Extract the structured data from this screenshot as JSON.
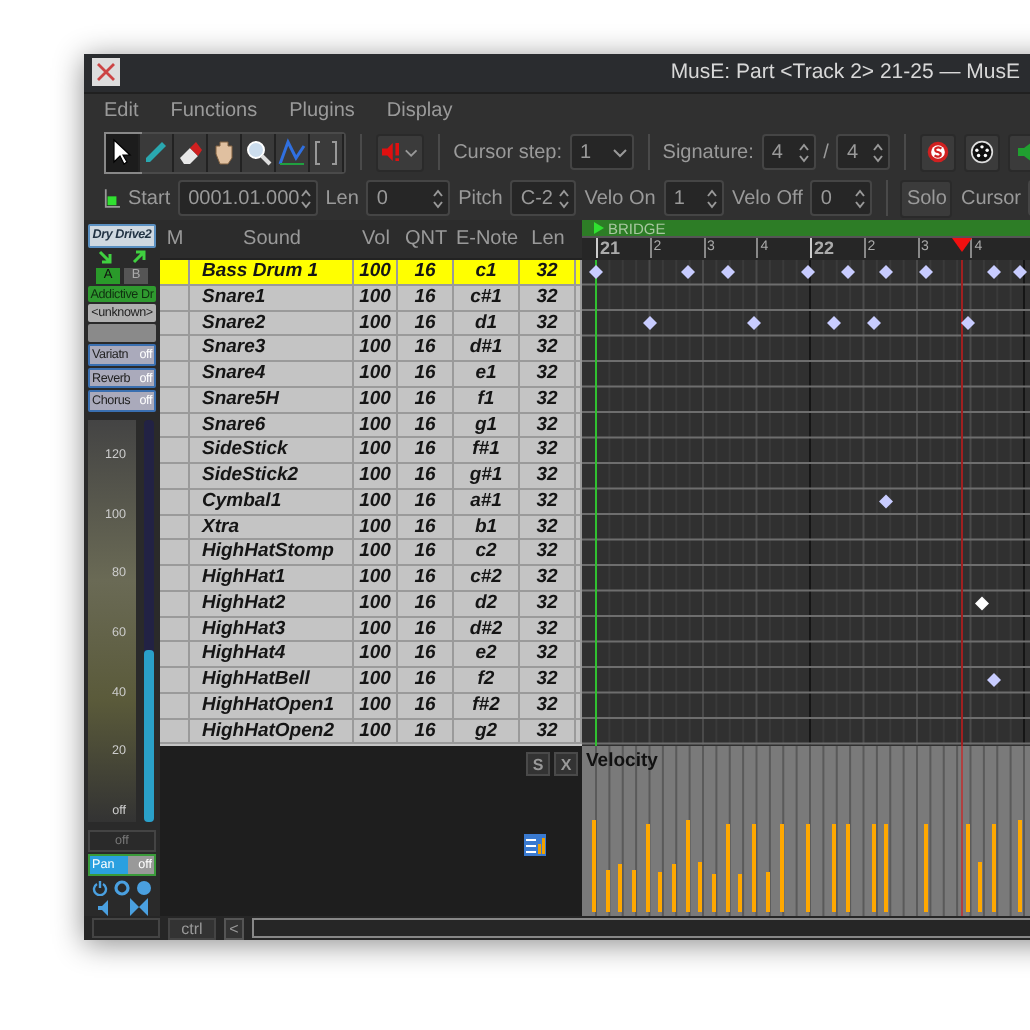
{
  "window": {
    "title": "MusE: Part <Track 2> 21-25 — MusE"
  },
  "menu": [
    "Edit",
    "Functions",
    "Plugins",
    "Display"
  ],
  "tools": [
    {
      "kind": "pointer",
      "selected": true
    },
    {
      "kind": "pencil",
      "selected": false
    },
    {
      "kind": "eraser",
      "selected": false
    },
    {
      "kind": "hand",
      "selected": false
    },
    {
      "kind": "zoom",
      "selected": false
    },
    {
      "kind": "curve",
      "selected": false
    },
    {
      "kind": "range",
      "selected": false
    }
  ],
  "cursor_step": {
    "label": "Cursor step:",
    "value": "1"
  },
  "signature": {
    "label": "Signature:",
    "numerator": "4",
    "separator": "/",
    "denominator": "4"
  },
  "note_info": {
    "start_label": "Start",
    "start": "0001.01.000",
    "len_label": "Len",
    "len": "0",
    "pitch_label": "Pitch",
    "pitch": "C-2",
    "velo_on_label": "Velo On",
    "velo_on": "1",
    "velo_off_label": "Velo Off",
    "velo_off": "0",
    "solo": "Solo",
    "cursor_label": "Cursor"
  },
  "strip": {
    "name": "Dry Drive2",
    "routes": [
      {
        "label": "A",
        "selected": true
      },
      {
        "label": "B",
        "selected": false
      }
    ],
    "instrument": "Addictive Dr",
    "port": "<unknown>",
    "effects": [
      {
        "label": "Variatn",
        "value": "off"
      },
      {
        "label": "Reverb",
        "value": "off"
      },
      {
        "label": "Chorus",
        "value": "off"
      }
    ],
    "scale": [
      "120",
      "100",
      "80",
      "60",
      "40",
      "20",
      "off"
    ],
    "fader": {
      "level": 0.43
    },
    "volume": "off",
    "pan": {
      "label": "Pan",
      "value": "off"
    }
  },
  "columns": [
    "M",
    "Sound",
    "Vol",
    "QNT",
    "E-Note",
    "Len"
  ],
  "rows": [
    {
      "sound": "Bass Drum 1",
      "vol": "100",
      "qnt": "16",
      "enote": "c1",
      "len": "32",
      "selected": true
    },
    {
      "sound": "Snare1",
      "vol": "100",
      "qnt": "16",
      "enote": "c#1",
      "len": "32",
      "selected": false
    },
    {
      "sound": "Snare2",
      "vol": "100",
      "qnt": "16",
      "enote": "d1",
      "len": "32",
      "selected": false
    },
    {
      "sound": "Snare3",
      "vol": "100",
      "qnt": "16",
      "enote": "d#1",
      "len": "32",
      "selected": false
    },
    {
      "sound": "Snare4",
      "vol": "100",
      "qnt": "16",
      "enote": "e1",
      "len": "32",
      "selected": false
    },
    {
      "sound": "Snare5H",
      "vol": "100",
      "qnt": "16",
      "enote": "f1",
      "len": "32",
      "selected": false
    },
    {
      "sound": "Snare6",
      "vol": "100",
      "qnt": "16",
      "enote": "g1",
      "len": "32",
      "selected": false
    },
    {
      "sound": "SideStick",
      "vol": "100",
      "qnt": "16",
      "enote": "f#1",
      "len": "32",
      "selected": false
    },
    {
      "sound": "SideStick2",
      "vol": "100",
      "qnt": "16",
      "enote": "g#1",
      "len": "32",
      "selected": false
    },
    {
      "sound": "Cymbal1",
      "vol": "100",
      "qnt": "16",
      "enote": "a#1",
      "len": "32",
      "selected": false
    },
    {
      "sound": "Xtra",
      "vol": "100",
      "qnt": "16",
      "enote": "b1",
      "len": "32",
      "selected": false
    },
    {
      "sound": "HighHatStomp",
      "vol": "100",
      "qnt": "16",
      "enote": "c2",
      "len": "32",
      "selected": false
    },
    {
      "sound": "HighHat1",
      "vol": "100",
      "qnt": "16",
      "enote": "c#2",
      "len": "32",
      "selected": false
    },
    {
      "sound": "HighHat2",
      "vol": "100",
      "qnt": "16",
      "enote": "d2",
      "len": "32",
      "selected": false
    },
    {
      "sound": "HighHat3",
      "vol": "100",
      "qnt": "16",
      "enote": "d#2",
      "len": "32",
      "selected": false
    },
    {
      "sound": "HighHat4",
      "vol": "100",
      "qnt": "16",
      "enote": "e2",
      "len": "32",
      "selected": false
    },
    {
      "sound": "HighHatBell",
      "vol": "100",
      "qnt": "16",
      "enote": "f2",
      "len": "32",
      "selected": false
    },
    {
      "sound": "HighHatOpen1",
      "vol": "100",
      "qnt": "16",
      "enote": "f#2",
      "len": "32",
      "selected": false
    },
    {
      "sound": "HighHatOpen2",
      "vol": "100",
      "qnt": "16",
      "enote": "g2",
      "len": "32",
      "selected": false
    }
  ],
  "marker": "BRIDGE",
  "ruler": [
    "21",
    "2",
    "3",
    "4",
    "22",
    "2",
    "3",
    "4"
  ],
  "controller": {
    "label": "Velocity",
    "buttons": [
      "S",
      "X"
    ]
  },
  "bottom": {
    "ctrl": "ctrl",
    "scroll_left": "<"
  }
}
